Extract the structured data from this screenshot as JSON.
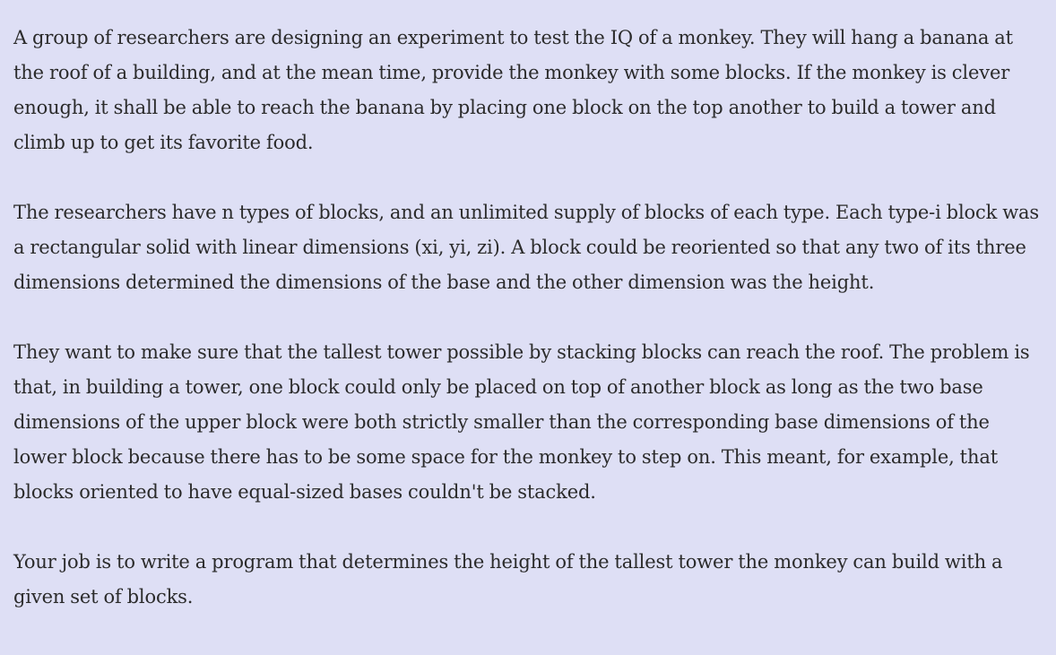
{
  "problem": {
    "paragraphs": [
      "A group of researchers are designing an experiment to test the IQ of a monkey. They will hang a banana at the roof of a building, and at the mean time, provide the monkey with some blocks. If the monkey is clever enough, it shall be able to reach the banana by placing one block on the top another to build a tower and climb up to get its favorite food.",
      "The researchers have n types of blocks, and an unlimited supply of blocks of each type. Each type-i block was a rectangular solid with linear dimensions (xi, yi, zi). A block could be reoriented so that any two of its three dimensions determined the dimensions of the base and the other dimension was the height.",
      "They want to make sure that the tallest tower possible by stacking blocks can reach the roof. The problem is that, in building a tower, one block could only be placed on top of another block as long as the two base dimensions of the upper block were both strictly smaller than the corresponding base dimensions of the lower block because there has to be some space for the monkey to step on. This meant, for example, that blocks oriented to have equal-sized bases couldn't be stacked.",
      "Your job is to write a program that determines the height of the tallest tower the monkey can build with a given set of blocks."
    ]
  },
  "colors": {
    "background": "#dedff5",
    "text": "#2b2b2b"
  }
}
